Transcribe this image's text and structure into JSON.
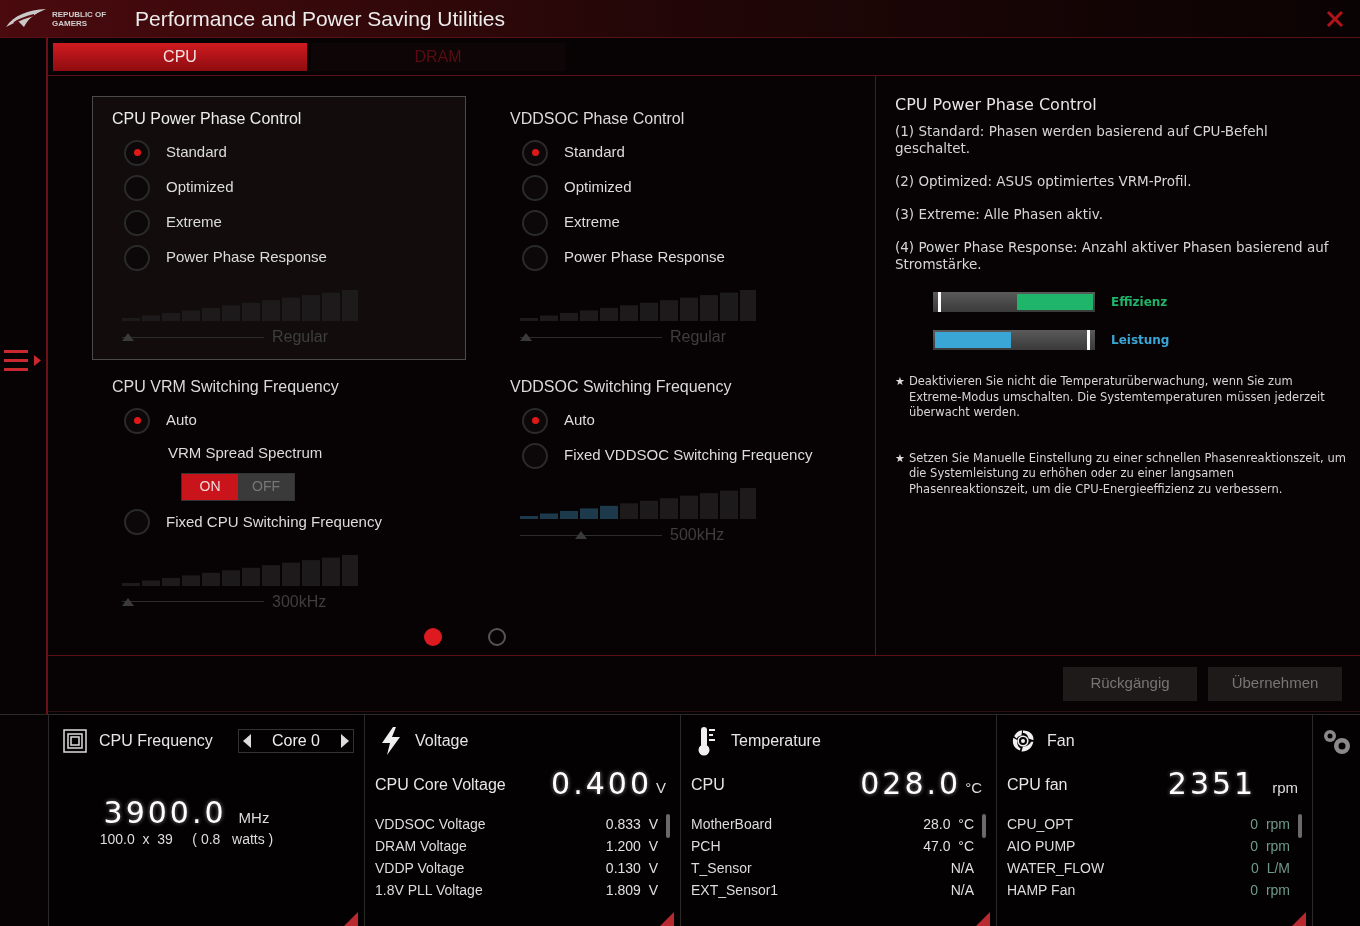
{
  "window": {
    "title": "Performance and Power Saving Utilities",
    "logo_text": [
      "REPUBLIC OF",
      "GAMERS"
    ]
  },
  "tabs": [
    {
      "label": "CPU",
      "selected": true
    },
    {
      "label": "DRAM",
      "selected": false
    }
  ],
  "groups": [
    {
      "title": "CPU Power Phase Control",
      "focused": true,
      "options": [
        {
          "kind": "radio",
          "label": "Standard",
          "selected": true
        },
        {
          "kind": "radio",
          "label": "Optimized",
          "selected": false
        },
        {
          "kind": "radio",
          "label": "Extreme",
          "selected": false
        },
        {
          "kind": "radio",
          "label": "Power Phase Response",
          "selected": false
        }
      ],
      "slider": {
        "label": "Regular",
        "level": 0
      }
    },
    {
      "title": "VDDSOC Phase Control",
      "focused": false,
      "options": [
        {
          "kind": "radio",
          "label": "Standard",
          "selected": true
        },
        {
          "kind": "radio",
          "label": "Optimized",
          "selected": false
        },
        {
          "kind": "radio",
          "label": "Extreme",
          "selected": false
        },
        {
          "kind": "radio",
          "label": "Power Phase Response",
          "selected": false
        }
      ],
      "slider": {
        "label": "Regular",
        "level": 0
      }
    },
    {
      "title": "CPU VRM Switching Frequency",
      "focused": false,
      "options": [
        {
          "kind": "radio",
          "label": "Auto",
          "selected": true
        },
        {
          "kind": "toggle",
          "label": "VRM Spread Spectrum",
          "on": true,
          "on_label": "ON",
          "off_label": "OFF"
        },
        {
          "kind": "radio",
          "label": "Fixed CPU Switching Frequency",
          "selected": false
        }
      ],
      "slider": {
        "label": "300kHz",
        "level": 0
      }
    },
    {
      "title": "VDDSOC Switching Frequency",
      "focused": false,
      "options": [
        {
          "kind": "radio",
          "label": "Auto",
          "selected": true
        },
        {
          "kind": "radio",
          "label": "Fixed VDDSOC Switching Frequency",
          "selected": false
        }
      ],
      "slider": {
        "label": "500kHz",
        "level": 0.42
      }
    }
  ],
  "pages": [
    {
      "selected": true
    },
    {
      "selected": false
    }
  ],
  "info": {
    "title": "CPU Power Phase Control",
    "paragraphs": [
      "(1) Standard: Phasen werden basierend auf CPU-Befehl geschaltet.",
      "(2) Optimized: ASUS optimiertes VRM-Profil.",
      "(3) Extreme: Alle Phasen aktiv.",
      "(4) Power Phase Response: Anzahl aktiver Phasen basierend auf Stromstärke."
    ],
    "meters": [
      {
        "label": "Effizienz",
        "kind": "reverse",
        "level": 0.48,
        "color": "#1fb56a"
      },
      {
        "label": "Leistung",
        "kind": "forward",
        "level": 0.48,
        "color": "#3aa6d6"
      }
    ],
    "notes": [
      {
        "bullet": "★",
        "text": "Deaktivieren Sie nicht die Temperaturüberwachung, wenn Sie zum Extreme-Modus umschalten. Die Systemtemperaturen müssen jederzeit überwacht werden."
      },
      {
        "bullet": "★",
        "text": "Setzen Sie Manuelle Einstellung zu einer schnellen Phasenreaktionszeit, um die Systemleistung zu erhöhen oder zu einer langsamen Phasenreaktionszeit, um die CPU-Energieeffizienz zu verbessern."
      }
    ]
  },
  "buttons": [
    {
      "label": "Rückgängig",
      "disabled": true
    },
    {
      "label": "Übernehmen",
      "disabled": true
    }
  ],
  "monitors": [
    {
      "kind": "frequency",
      "title": "CPU Frequency",
      "selector": "Core 0",
      "value": "3900.0",
      "unit": "MHz",
      "detail": "100.0  x  39     ( 0.8   watts )"
    },
    {
      "kind": "voltage",
      "title": "Voltage",
      "main_label": "CPU Core Voltage",
      "value": "0.400",
      "unit": "V",
      "rows": [
        {
          "label": "VDDSOC Voltage",
          "value": "0.833",
          "unit": "V"
        },
        {
          "label": "DRAM Voltage",
          "value": "1.200",
          "unit": "V"
        },
        {
          "label": "VDDP Voltage",
          "value": "0.130",
          "unit": "V"
        },
        {
          "label": "1.8V PLL Voltage",
          "value": "1.809",
          "unit": "V"
        }
      ]
    },
    {
      "kind": "temperature",
      "title": "Temperature",
      "main_label": "CPU",
      "value": "028.0",
      "unit": "°C",
      "rows": [
        {
          "label": "MotherBoard",
          "value": "28.0",
          "unit": "°C"
        },
        {
          "label": "PCH",
          "value": "47.0",
          "unit": "°C"
        },
        {
          "label": "T_Sensor",
          "value": "N/A"
        },
        {
          "label": "EXT_Sensor1",
          "value": "N/A"
        }
      ]
    },
    {
      "kind": "fan",
      "title": "Fan",
      "main_label": "CPU fan",
      "value": "2351",
      "unit": "rpm",
      "rows": [
        {
          "label": "CPU_OPT",
          "value": "0",
          "unit": "rpm"
        },
        {
          "label": "AIO PUMP",
          "value": "0",
          "unit": "rpm"
        },
        {
          "label": "WATER_FLOW",
          "value": "0",
          "unit": "L/M"
        },
        {
          "label": "HAMP Fan",
          "value": "0",
          "unit": "rpm"
        }
      ]
    }
  ]
}
